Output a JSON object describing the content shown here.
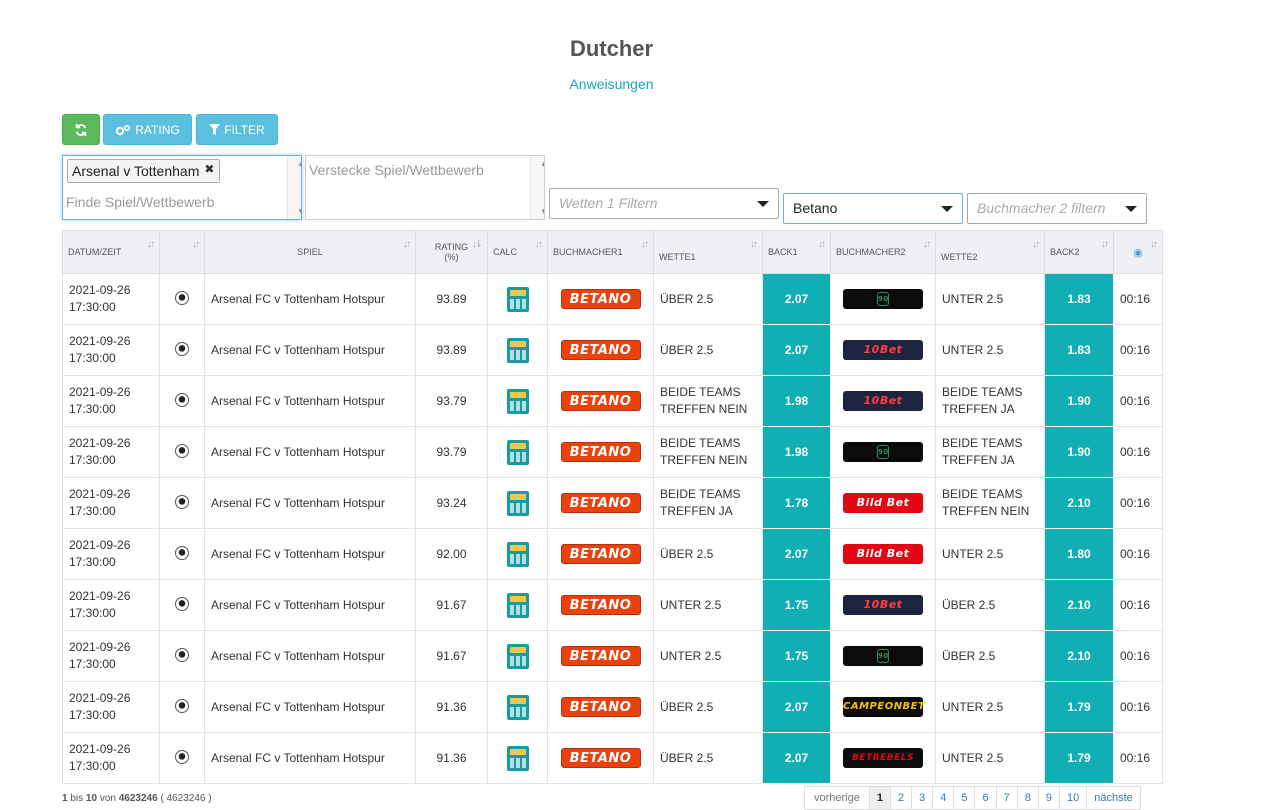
{
  "page": {
    "title": "Dutcher",
    "instructions_link": "Anweisungen"
  },
  "toolbar": {
    "refresh_icon": "refresh-icon",
    "rating_label": "RATING",
    "filter_label": "FILTER"
  },
  "filters": {
    "selected_match_tag": "Arsenal v Tottenham",
    "find_placeholder": "Finde Spiel/Wettbewerb",
    "hide_placeholder": "Verstecke Spiel/Wettbewerb",
    "bets1_placeholder": "Wetten 1 Filtern",
    "bookmaker1_value": "Betano",
    "bookmaker2_placeholder": "Buchmacher 2 filtern"
  },
  "table": {
    "headers": {
      "datetime": "DATUM/ZEIT",
      "match": "SPIEL",
      "rating": "RATING",
      "rating_unit": "(%)",
      "calc": "CALC",
      "bookmaker1": "BUCHMACHER1",
      "bet1": "WETTE1",
      "back1": "BACK1",
      "bookmaker2": "BUCHMACHER2",
      "bet2": "WETTE2",
      "back2": "BACK2"
    },
    "rows": [
      {
        "date": "2021-09-26",
        "time": "17:30:00",
        "match": "Arsenal FC v Tottenham Hotspur",
        "rating": "93.89",
        "bm1": "BETANO",
        "bet1": "ÜBER 2.5",
        "back1": "2.07",
        "bm2": "90",
        "bet2": "UNTER 2.5",
        "back2": "1.83",
        "age": "00:16"
      },
      {
        "date": "2021-09-26",
        "time": "17:30:00",
        "match": "Arsenal FC v Tottenham Hotspur",
        "rating": "93.89",
        "bm1": "BETANO",
        "bet1": "ÜBER 2.5",
        "back1": "2.07",
        "bm2": "10Bet",
        "bet2": "UNTER 2.5",
        "back2": "1.83",
        "age": "00:16"
      },
      {
        "date": "2021-09-26",
        "time": "17:30:00",
        "match": "Arsenal FC v Tottenham Hotspur",
        "rating": "93.79",
        "bm1": "BETANO",
        "bet1": "BEIDE TEAMS TREFFEN NEIN",
        "back1": "1.98",
        "bm2": "10Bet",
        "bet2": "BEIDE TEAMS TREFFEN JA",
        "back2": "1.90",
        "age": "00:16"
      },
      {
        "date": "2021-09-26",
        "time": "17:30:00",
        "match": "Arsenal FC v Tottenham Hotspur",
        "rating": "93.79",
        "bm1": "BETANO",
        "bet1": "BEIDE TEAMS TREFFEN NEIN",
        "back1": "1.98",
        "bm2": "90",
        "bet2": "BEIDE TEAMS TREFFEN JA",
        "back2": "1.90",
        "age": "00:16"
      },
      {
        "date": "2021-09-26",
        "time": "17:30:00",
        "match": "Arsenal FC v Tottenham Hotspur",
        "rating": "93.24",
        "bm1": "BETANO",
        "bet1": "BEIDE TEAMS TREFFEN JA",
        "back1": "1.78",
        "bm2": "Bild Bet",
        "bet2": "BEIDE TEAMS TREFFEN NEIN",
        "back2": "2.10",
        "age": "00:16"
      },
      {
        "date": "2021-09-26",
        "time": "17:30:00",
        "match": "Arsenal FC v Tottenham Hotspur",
        "rating": "92.00",
        "bm1": "BETANO",
        "bet1": "ÜBER 2.5",
        "back1": "2.07",
        "bm2": "Bild Bet",
        "bet2": "UNTER 2.5",
        "back2": "1.80",
        "age": "00:16"
      },
      {
        "date": "2021-09-26",
        "time": "17:30:00",
        "match": "Arsenal FC v Tottenham Hotspur",
        "rating": "91.67",
        "bm1": "BETANO",
        "bet1": "UNTER 2.5",
        "back1": "1.75",
        "bm2": "10Bet",
        "bet2": "ÜBER 2.5",
        "back2": "2.10",
        "age": "00:16"
      },
      {
        "date": "2021-09-26",
        "time": "17:30:00",
        "match": "Arsenal FC v Tottenham Hotspur",
        "rating": "91.67",
        "bm1": "BETANO",
        "bet1": "UNTER 2.5",
        "back1": "1.75",
        "bm2": "90",
        "bet2": "ÜBER 2.5",
        "back2": "2.10",
        "age": "00:16"
      },
      {
        "date": "2021-09-26",
        "time": "17:30:00",
        "match": "Arsenal FC v Tottenham Hotspur",
        "rating": "91.36",
        "bm1": "BETANO",
        "bet1": "ÜBER 2.5",
        "back1": "2.07",
        "bm2": "CAMPEONBET",
        "bet2": "UNTER 2.5",
        "back2": "1.79",
        "age": "00:16"
      },
      {
        "date": "2021-09-26",
        "time": "17:30:00",
        "match": "Arsenal FC v Tottenham Hotspur",
        "rating": "91.36",
        "bm1": "BETANO",
        "bet1": "ÜBER 2.5",
        "back1": "2.07",
        "bm2": "BETREBELS",
        "bet2": "UNTER 2.5",
        "back2": "1.79",
        "age": "00:16"
      }
    ]
  },
  "footer": {
    "range_from": "1",
    "range_text": "bis",
    "range_to": "10",
    "of_text": "von",
    "total": "4623246",
    "total_paren": "( 4623246 )"
  },
  "pagination": {
    "prev": "vorherige",
    "pages": [
      "1",
      "2",
      "3",
      "4",
      "5",
      "6",
      "7",
      "8",
      "9",
      "10"
    ],
    "next": "nächste"
  },
  "colors": {
    "accent_teal": "#11aeb4",
    "refresh_green": "#5cb85c",
    "button_blue": "#5bc0de",
    "betano_orange": "#e8430e"
  }
}
